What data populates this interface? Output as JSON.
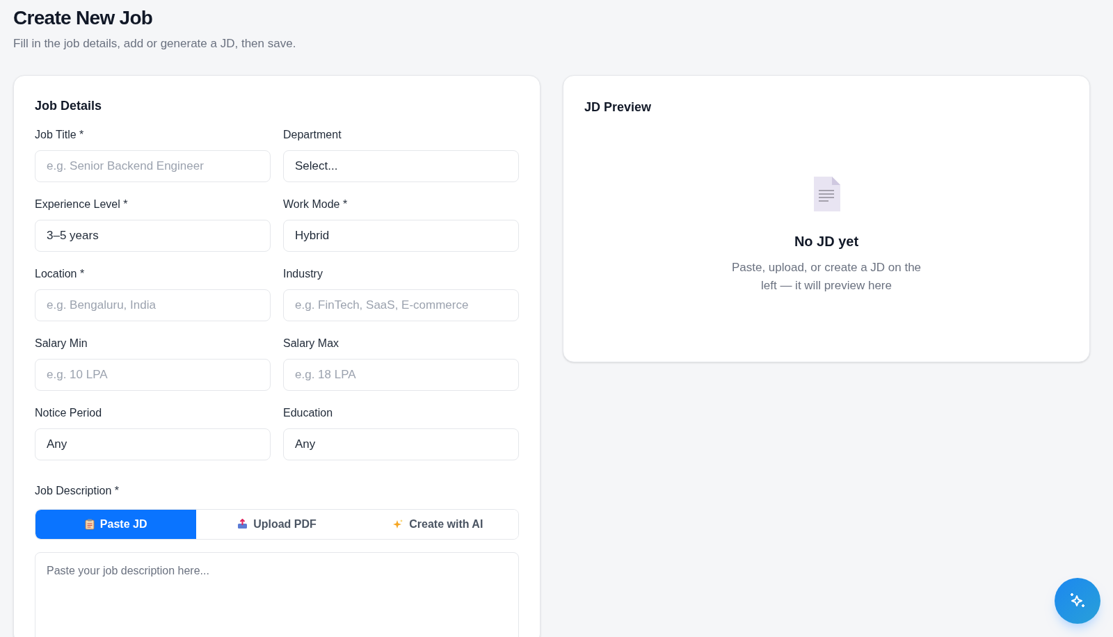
{
  "page": {
    "title": "Create New Job",
    "subtitle": "Fill in the job details, add or generate a JD, then save."
  },
  "job_details": {
    "title": "Job Details",
    "fields": [
      {
        "label": "Job Title *",
        "kind": "input",
        "placeholder": "e.g. Senior Backend Engineer"
      },
      {
        "label": "Department",
        "kind": "select",
        "value": "Select..."
      },
      {
        "label": "Experience Level *",
        "kind": "select",
        "value": "3–5 years"
      },
      {
        "label": "Work Mode *",
        "kind": "select",
        "value": "Hybrid"
      },
      {
        "label": "Location *",
        "kind": "input",
        "placeholder": "e.g. Bengaluru, India"
      },
      {
        "label": "Industry",
        "kind": "input",
        "placeholder": "e.g. FinTech, SaaS, E-commerce"
      },
      {
        "label": "Salary Min",
        "kind": "input",
        "placeholder": "e.g. 10 LPA"
      },
      {
        "label": "Salary Max",
        "kind": "input",
        "placeholder": "e.g. 18 LPA"
      },
      {
        "label": "Notice Period",
        "kind": "select",
        "value": "Any"
      },
      {
        "label": "Education",
        "kind": "select",
        "value": "Any"
      }
    ],
    "description": {
      "label": "Job Description *",
      "tabs": [
        {
          "label": "Paste JD",
          "kind": "paste",
          "selected": true
        },
        {
          "label": "Upload PDF",
          "kind": "upload",
          "selected": false
        },
        {
          "label": "Create with AI",
          "kind": "ai",
          "selected": false
        }
      ],
      "placeholder": "Paste your job description here..."
    }
  },
  "preview": {
    "title": "JD Preview",
    "empty_title": "No JD yet",
    "empty_text": "Paste, upload, or create a JD on the left — it will preview here"
  }
}
